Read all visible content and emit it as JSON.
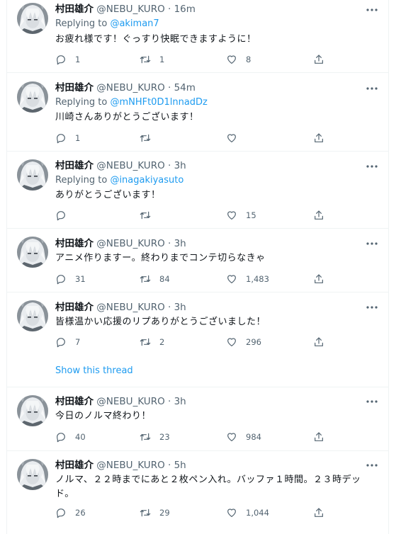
{
  "author": {
    "name": "村田雄介",
    "handle": "@NEBU_KURO"
  },
  "tweets": [
    {
      "time": "· 16m",
      "replying_label": "Replying to",
      "replying_to": "@akiman7",
      "text": "お疲れ様です！ぐっすり快眠できますように！",
      "replies": "1",
      "retweets": "1",
      "likes": "8"
    },
    {
      "time": "· 54m",
      "replying_label": "Replying to",
      "replying_to": "@mNHFt0D1lnnadDz",
      "text": "川崎さんありがとうございます！",
      "replies": "1",
      "retweets": "",
      "likes": ""
    },
    {
      "time": "· 3h",
      "replying_label": "Replying to",
      "replying_to": "@inagakiyasuto",
      "text": "ありがとうございます！",
      "replies": "",
      "retweets": "",
      "likes": "15"
    },
    {
      "time": "· 3h",
      "text": "アニメ作りますー。終わりまでコンテ切らなきゃ",
      "replies": "31",
      "retweets": "84",
      "likes": "1,483"
    },
    {
      "time": "· 3h",
      "text": "皆様温かい応援のリプありがとうございました！",
      "replies": "7",
      "retweets": "2",
      "likes": "296"
    },
    {
      "time": "· 3h",
      "text": "今日のノルマ終わり！",
      "replies": "40",
      "retweets": "23",
      "likes": "984"
    },
    {
      "time": "· 5h",
      "text_line1": "ノルマ、２２時までにあと２枚ペン入れ。バッファ１時間。２３時デッ",
      "text_line2": "ド。",
      "replies": "26",
      "retweets": "29",
      "likes": "1,044"
    }
  ],
  "show_thread": "Show this thread",
  "icons": [
    "more-icon",
    "reply-icon",
    "retweet-icon",
    "like-icon",
    "share-icon"
  ],
  "colors": {
    "link": "#1d9bf0",
    "secondary": "#536471",
    "border": "#eff3f4"
  }
}
